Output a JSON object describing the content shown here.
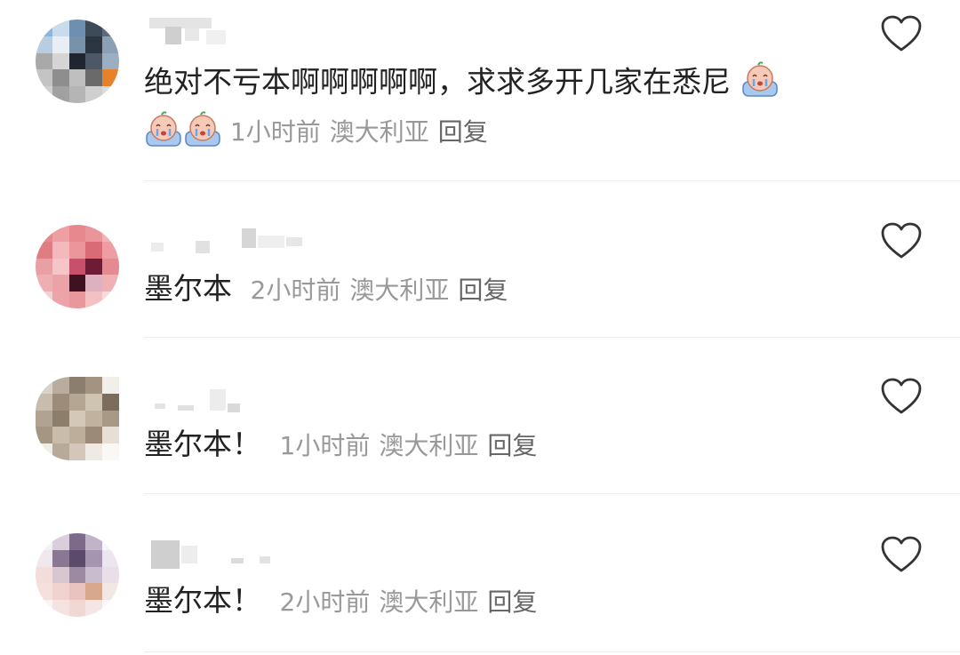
{
  "comments": [
    {
      "text": "绝对不亏本啊啊啊啊啊，求求多开几家在悉尼",
      "time": "1小时前",
      "location": "澳大利亚",
      "reply_label": "回复",
      "avatar_icon": "blurred-avatar"
    },
    {
      "text": "墨尔本",
      "time": "2小时前",
      "location": "澳大利亚",
      "reply_label": "回复",
      "avatar_icon": "blurred-avatar"
    },
    {
      "text": "墨尔本！",
      "time": "1小时前",
      "location": "澳大利亚",
      "reply_label": "回复",
      "avatar_icon": "blurred-avatar"
    },
    {
      "text": "墨尔本！",
      "time": "2小时前",
      "location": "澳大利亚",
      "reply_label": "回复",
      "avatar_icon": "blurred-avatar"
    }
  ],
  "icons": {
    "like": "heart-outline-icon",
    "emoji": "crying-face-emoji"
  },
  "colors": {
    "text": "#222222",
    "meta": "#999999",
    "reply": "#666666",
    "heart_stroke": "#333333"
  }
}
